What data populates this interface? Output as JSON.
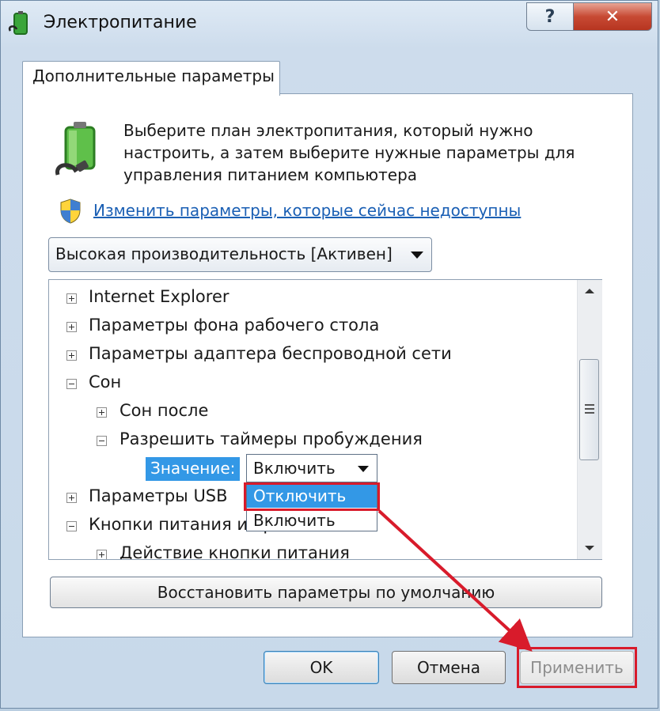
{
  "window": {
    "title": "Электропитание",
    "help_glyph": "?",
    "close_glyph": "✕"
  },
  "tab": {
    "label": "Дополнительные параметры"
  },
  "description": "Выберите план электропитания, который нужно настроить, а затем выберите нужные параметры для управления питанием компьютера",
  "change_link": "Изменить параметры, которые сейчас недоступны",
  "plan_select": {
    "value": "Высокая производительность [Активен]"
  },
  "tree": {
    "items": [
      {
        "label": "Internet Explorer",
        "toggle": "plus",
        "level": 0
      },
      {
        "label": "Параметры фона рабочего стола",
        "toggle": "plus",
        "level": 0
      },
      {
        "label": "Параметры адаптера беспроводной сети",
        "toggle": "plus",
        "level": 0
      },
      {
        "label": "Сон",
        "toggle": "minus",
        "level": 0
      },
      {
        "label": "Сон после",
        "toggle": "plus",
        "level": 1
      },
      {
        "label": "Разрешить таймеры пробуждения",
        "toggle": "minus",
        "level": 1
      },
      {
        "label": "Параметры USB",
        "toggle": "plus",
        "level": 0
      },
      {
        "label": "Кнопки питания и крышка",
        "toggle": "minus",
        "level": 0
      },
      {
        "label": "Действие кнопки питания",
        "toggle": "plus",
        "level": 1
      }
    ],
    "value_label": "Значение:",
    "value_select": "Включить",
    "dropdown_options": [
      "Отключить",
      "Включить"
    ]
  },
  "buttons": {
    "restore": "Восстановить параметры по умолчанию",
    "ok": "OK",
    "cancel": "Отмена",
    "apply": "Применить"
  },
  "colors": {
    "highlight": "#d81b2b",
    "selection": "#3398e6",
    "link": "#1a5fb4"
  }
}
